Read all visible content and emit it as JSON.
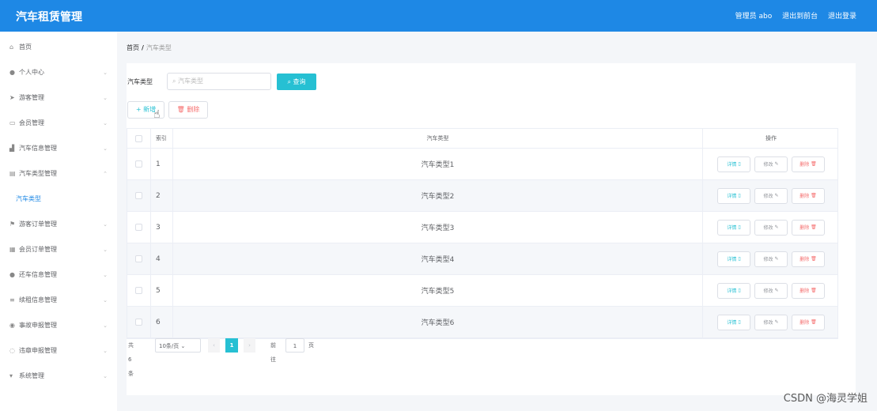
{
  "header": {
    "brand": "汽车租赁管理",
    "admin": "管理员 abo",
    "backstage": "退出到前台",
    "logout": "退出登录"
  },
  "sidebar": {
    "items": [
      {
        "label": "首页",
        "icon": "home-icon",
        "glyph": "⌂",
        "chevron": ""
      },
      {
        "label": "个人中心",
        "icon": "user-icon",
        "glyph": "●",
        "chevron": "⌄"
      },
      {
        "label": "游客管理",
        "icon": "send-icon",
        "glyph": "➤",
        "chevron": "⌄"
      },
      {
        "label": "会员管理",
        "icon": "card-icon",
        "glyph": "▭",
        "chevron": "⌄"
      },
      {
        "label": "汽车信息管理",
        "icon": "chart-icon",
        "glyph": "▟",
        "chevron": "⌄"
      },
      {
        "label": "汽车类型管理",
        "icon": "list-icon",
        "glyph": "▤",
        "chevron": "⌃"
      },
      {
        "label": "游客订单管理",
        "icon": "flag-icon",
        "glyph": "⚑",
        "chevron": "⌄"
      },
      {
        "label": "会员订单管理",
        "icon": "trash-icon",
        "glyph": "▦",
        "chevron": "⌄"
      },
      {
        "label": "还车信息管理",
        "icon": "user-icon",
        "glyph": "●",
        "chevron": "⌄"
      },
      {
        "label": "续租信息管理",
        "icon": "menu-icon",
        "glyph": "≡",
        "chevron": "⌄"
      },
      {
        "label": "事故申报管理",
        "icon": "pin-icon",
        "glyph": "◉",
        "chevron": "⌄"
      },
      {
        "label": "违章申报管理",
        "icon": "clock-icon",
        "glyph": "◌",
        "chevron": "⌄"
      },
      {
        "label": "系统管理",
        "icon": "shield-icon",
        "glyph": "▾",
        "chevron": "⌄"
      }
    ],
    "active_sub": "汽车类型"
  },
  "breadcrumb": {
    "home": "首页",
    "sep": "/",
    "current": "汽车类型"
  },
  "search": {
    "label": "汽车类型",
    "placeholder": "汽车类型",
    "button": "查询"
  },
  "actions": {
    "add": "新增",
    "delete": "删除"
  },
  "table": {
    "headers": {
      "index": "索引",
      "type": "汽车类型",
      "ops": "操作"
    },
    "rows": [
      {
        "index": "1",
        "type": "汽车类型1"
      },
      {
        "index": "2",
        "type": "汽车类型2"
      },
      {
        "index": "3",
        "type": "汽车类型3"
      },
      {
        "index": "4",
        "type": "汽车类型4"
      },
      {
        "index": "5",
        "type": "汽车类型5"
      },
      {
        "index": "6",
        "type": "汽车类型6"
      }
    ],
    "ops": {
      "detail": "详情",
      "edit": "修改",
      "remove": "删除"
    }
  },
  "pager": {
    "total": "共 6 条",
    "page_size": "10条/页",
    "current": "1",
    "goto_label": "前往",
    "goto_value": "1",
    "unit": "页"
  },
  "watermark": "CSDN @海灵学姐",
  "colors": {
    "header": "#1e88e5",
    "accent": "#26c0d3",
    "danger": "#f56c6c"
  }
}
